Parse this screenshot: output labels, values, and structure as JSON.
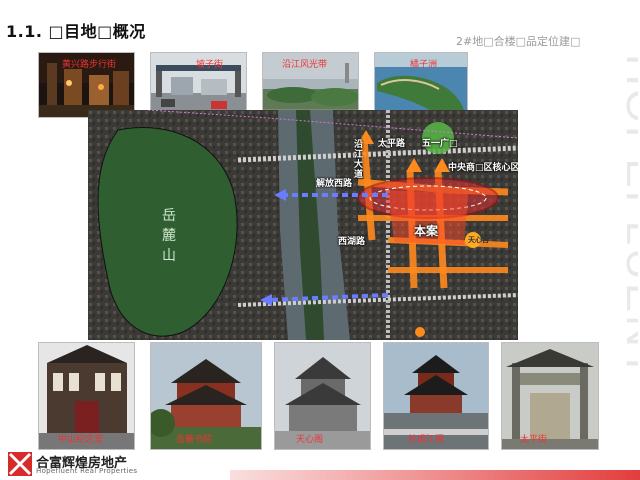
{
  "header": {
    "title": "1.1. □目地□概况",
    "subtitle": "2#地□合楼□品定位建□"
  },
  "brand": {
    "vertical_text": "HOPEFLUENT",
    "logo_cn": "合富辉煌房地产",
    "logo_en": "Hopefluent Real Properties",
    "accent_color": "#e02828"
  },
  "top_photos": [
    {
      "label": "黄兴路步行街"
    },
    {
      "label": "坡子街"
    },
    {
      "label": "沿江风光带"
    },
    {
      "label": "橘子洲"
    }
  ],
  "map": {
    "labels": {
      "taiping": "太平路",
      "wuyi": "五一广□",
      "yanjiang": "沿江大道",
      "jiefang": "解放西路",
      "cbd": "中央商□区核心区",
      "benan": "本案",
      "xihu": "西湖路",
      "tianxin": "天心古",
      "yuelu": "岳麓山"
    },
    "mountain_chars": [
      "岳",
      "麓",
      "山"
    ]
  },
  "bottom_photos": [
    {
      "label": "中山纪念堂"
    },
    {
      "label": "岳麓书院"
    },
    {
      "label": "天心阁"
    },
    {
      "label": "杜甫江阁"
    },
    {
      "label": "太平街"
    }
  ]
}
